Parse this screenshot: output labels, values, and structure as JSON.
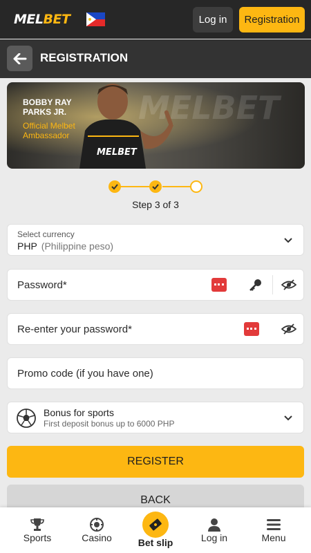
{
  "header": {
    "logo_main": "MEL",
    "logo_accent": "BET",
    "login_label": "Log in",
    "registration_label": "Registration"
  },
  "subheader": {
    "title": "REGISTRATION"
  },
  "banner": {
    "name": "BOBBY RAY PARKS JR.",
    "subtitle": "Official Melbet Ambassador",
    "watermark": "MELBET"
  },
  "stepper": {
    "text": "Step 3 of 3",
    "current_step": 3,
    "total_steps": 3
  },
  "form": {
    "currency": {
      "label": "Select currency",
      "code": "PHP",
      "name": "(Philippine peso)"
    },
    "password": {
      "label": "Password*"
    },
    "confirm_password": {
      "label": "Re-enter your password*"
    },
    "promo": {
      "label": "Promo code (if you have one)"
    },
    "bonus": {
      "title": "Bonus for sports",
      "subtitle": "First deposit bonus up to 6000 PHP"
    }
  },
  "buttons": {
    "register": "REGISTER",
    "back": "BACK"
  },
  "bottom_nav": [
    {
      "label": "Sports",
      "icon": "trophy-icon"
    },
    {
      "label": "Casino",
      "icon": "casino-chip-icon"
    },
    {
      "label": "Bet slip",
      "icon": "ticket-icon"
    },
    {
      "label": "Log in",
      "icon": "user-icon"
    },
    {
      "label": "Menu",
      "icon": "menu-icon"
    }
  ],
  "colors": {
    "accent": "#fdb712",
    "header_bg": "#272727",
    "subheader_bg": "#333333",
    "page_bg": "#ebebeb",
    "password_icon": "#e23a3a"
  }
}
